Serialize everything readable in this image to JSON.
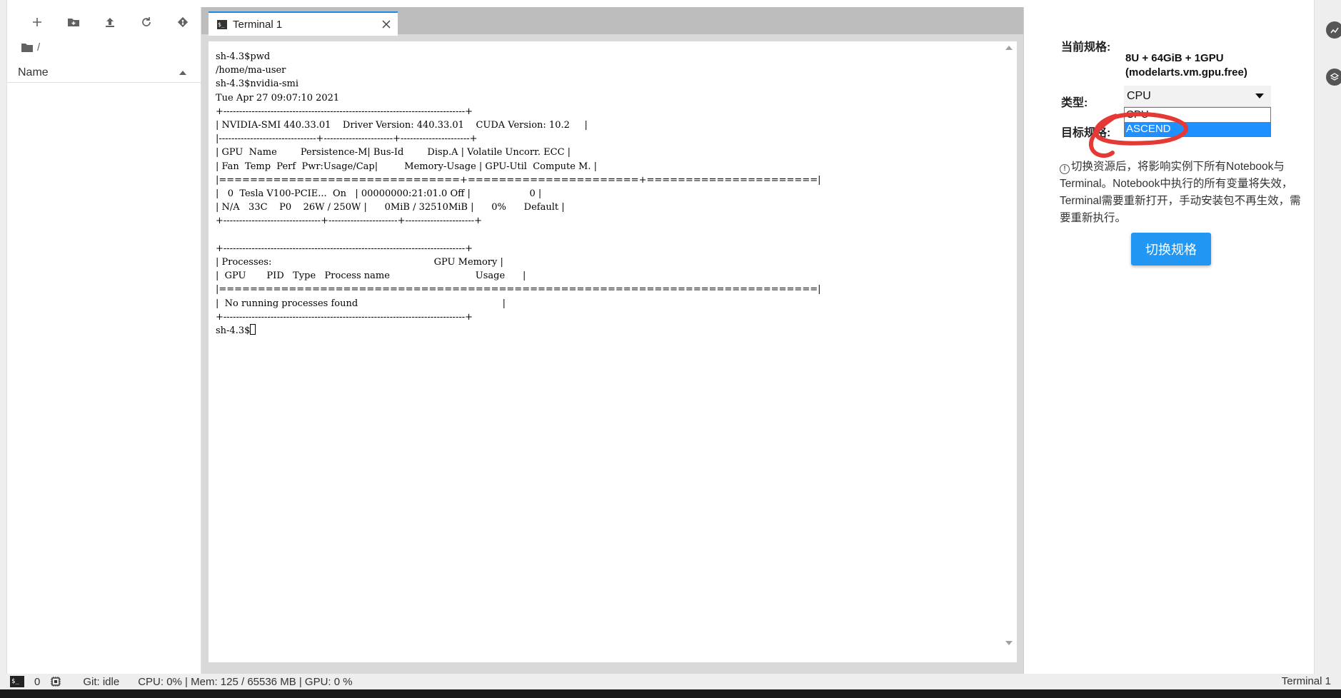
{
  "colors": {
    "accent": "#2196f3",
    "tab_border": "#1e88e5",
    "selected_option": "#1e90ff",
    "annotation": "#e53935"
  },
  "filebrowser": {
    "toolbar": [
      {
        "name": "new-launcher",
        "icon": "plus-icon"
      },
      {
        "name": "new-folder",
        "icon": "folder-plus-icon"
      },
      {
        "name": "upload",
        "icon": "upload-icon"
      },
      {
        "name": "refresh",
        "icon": "refresh-icon"
      },
      {
        "name": "git-clone",
        "icon": "git-icon"
      }
    ],
    "breadcrumb": "/",
    "column_header": "Name"
  },
  "tabs": [
    {
      "label": "Terminal 1",
      "icon": "terminal-icon"
    }
  ],
  "terminal": {
    "lines": [
      "sh-4.3$pwd",
      "/home/ma-user",
      "sh-4.3$nvidia-smi",
      "Tue Apr 27 09:07:10 2021",
      "+-----------------------------------------------------------------------------+",
      "| NVIDIA-SMI 440.33.01    Driver Version: 440.33.01    CUDA Version: 10.2     |",
      "|-------------------------------+----------------------+----------------------+",
      "| GPU  Name        Persistence-M| Bus-Id        Disp.A | Volatile Uncorr. ECC |",
      "| Fan  Temp  Perf  Pwr:Usage/Cap|         Memory-Usage | GPU-Util  Compute M. |",
      "|===============================+======================+======================|",
      "|   0  Tesla V100-PCIE...  On   | 00000000:21:01.0 Off |                    0 |",
      "| N/A   33C    P0    26W / 250W |      0MiB / 32510MiB |      0%      Default |",
      "+-------------------------------+----------------------+----------------------+",
      "",
      "+-----------------------------------------------------------------------------+",
      "| Processes:                                                       GPU Memory |",
      "|  GPU       PID   Type   Process name                             Usage      |",
      "|=============================================================================|",
      "|  No running processes found                                                 |",
      "+-----------------------------------------------------------------------------+"
    ],
    "prompt": "sh-4.3$"
  },
  "panel": {
    "current_spec_label": "当前规格:",
    "current_spec_line1": "8U + 64GiB + 1GPU",
    "current_spec_line2": "(modelarts.vm.gpu.free)",
    "type_label": "类型:",
    "type_value": "CPU",
    "type_options": [
      "CPU",
      "ASCEND"
    ],
    "type_highlighted": "ASCEND",
    "target_label": "目标规格:",
    "note": "切换资源后，将影响实例下所有Notebook与Terminal。Notebook中执行的所有变量将失效，Terminal需要重新打开，手动安装包不再生效，需要重新执行。",
    "switch_button": "切换规格"
  },
  "statusbar": {
    "terminals_count": "0",
    "git_status": "Git: idle",
    "resources": "CPU: 0% | Mem: 125 / 65536 MB | GPU: 0 %",
    "active": "Terminal 1"
  }
}
